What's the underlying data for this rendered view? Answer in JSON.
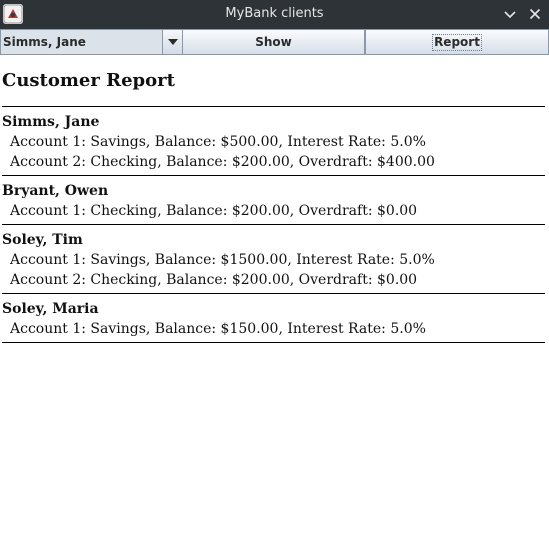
{
  "window": {
    "title": "MyBank clients",
    "app_icon": "duke-java-icon"
  },
  "toolbar": {
    "selected_client": "Simms, Jane",
    "show_label": "Show",
    "report_label": "Report"
  },
  "report": {
    "title": "Customer Report",
    "customers": [
      {
        "name": "Simms, Jane",
        "accounts": [
          "Account 1: Savings, Balance: $500.00, Interest Rate: 5.0%",
          "Account 2: Checking, Balance: $200.00, Overdraft: $400.00"
        ]
      },
      {
        "name": "Bryant, Owen",
        "accounts": [
          "Account 1: Checking, Balance: $200.00, Overdraft: $0.00"
        ]
      },
      {
        "name": "Soley, Tim",
        "accounts": [
          "Account 1: Savings, Balance: $1500.00, Interest Rate: 5.0%",
          "Account 2: Checking, Balance: $200.00, Overdraft: $0.00"
        ]
      },
      {
        "name": "Soley, Maria",
        "accounts": [
          "Account 1: Savings, Balance: $150.00, Interest Rate: 5.0%"
        ]
      }
    ]
  }
}
